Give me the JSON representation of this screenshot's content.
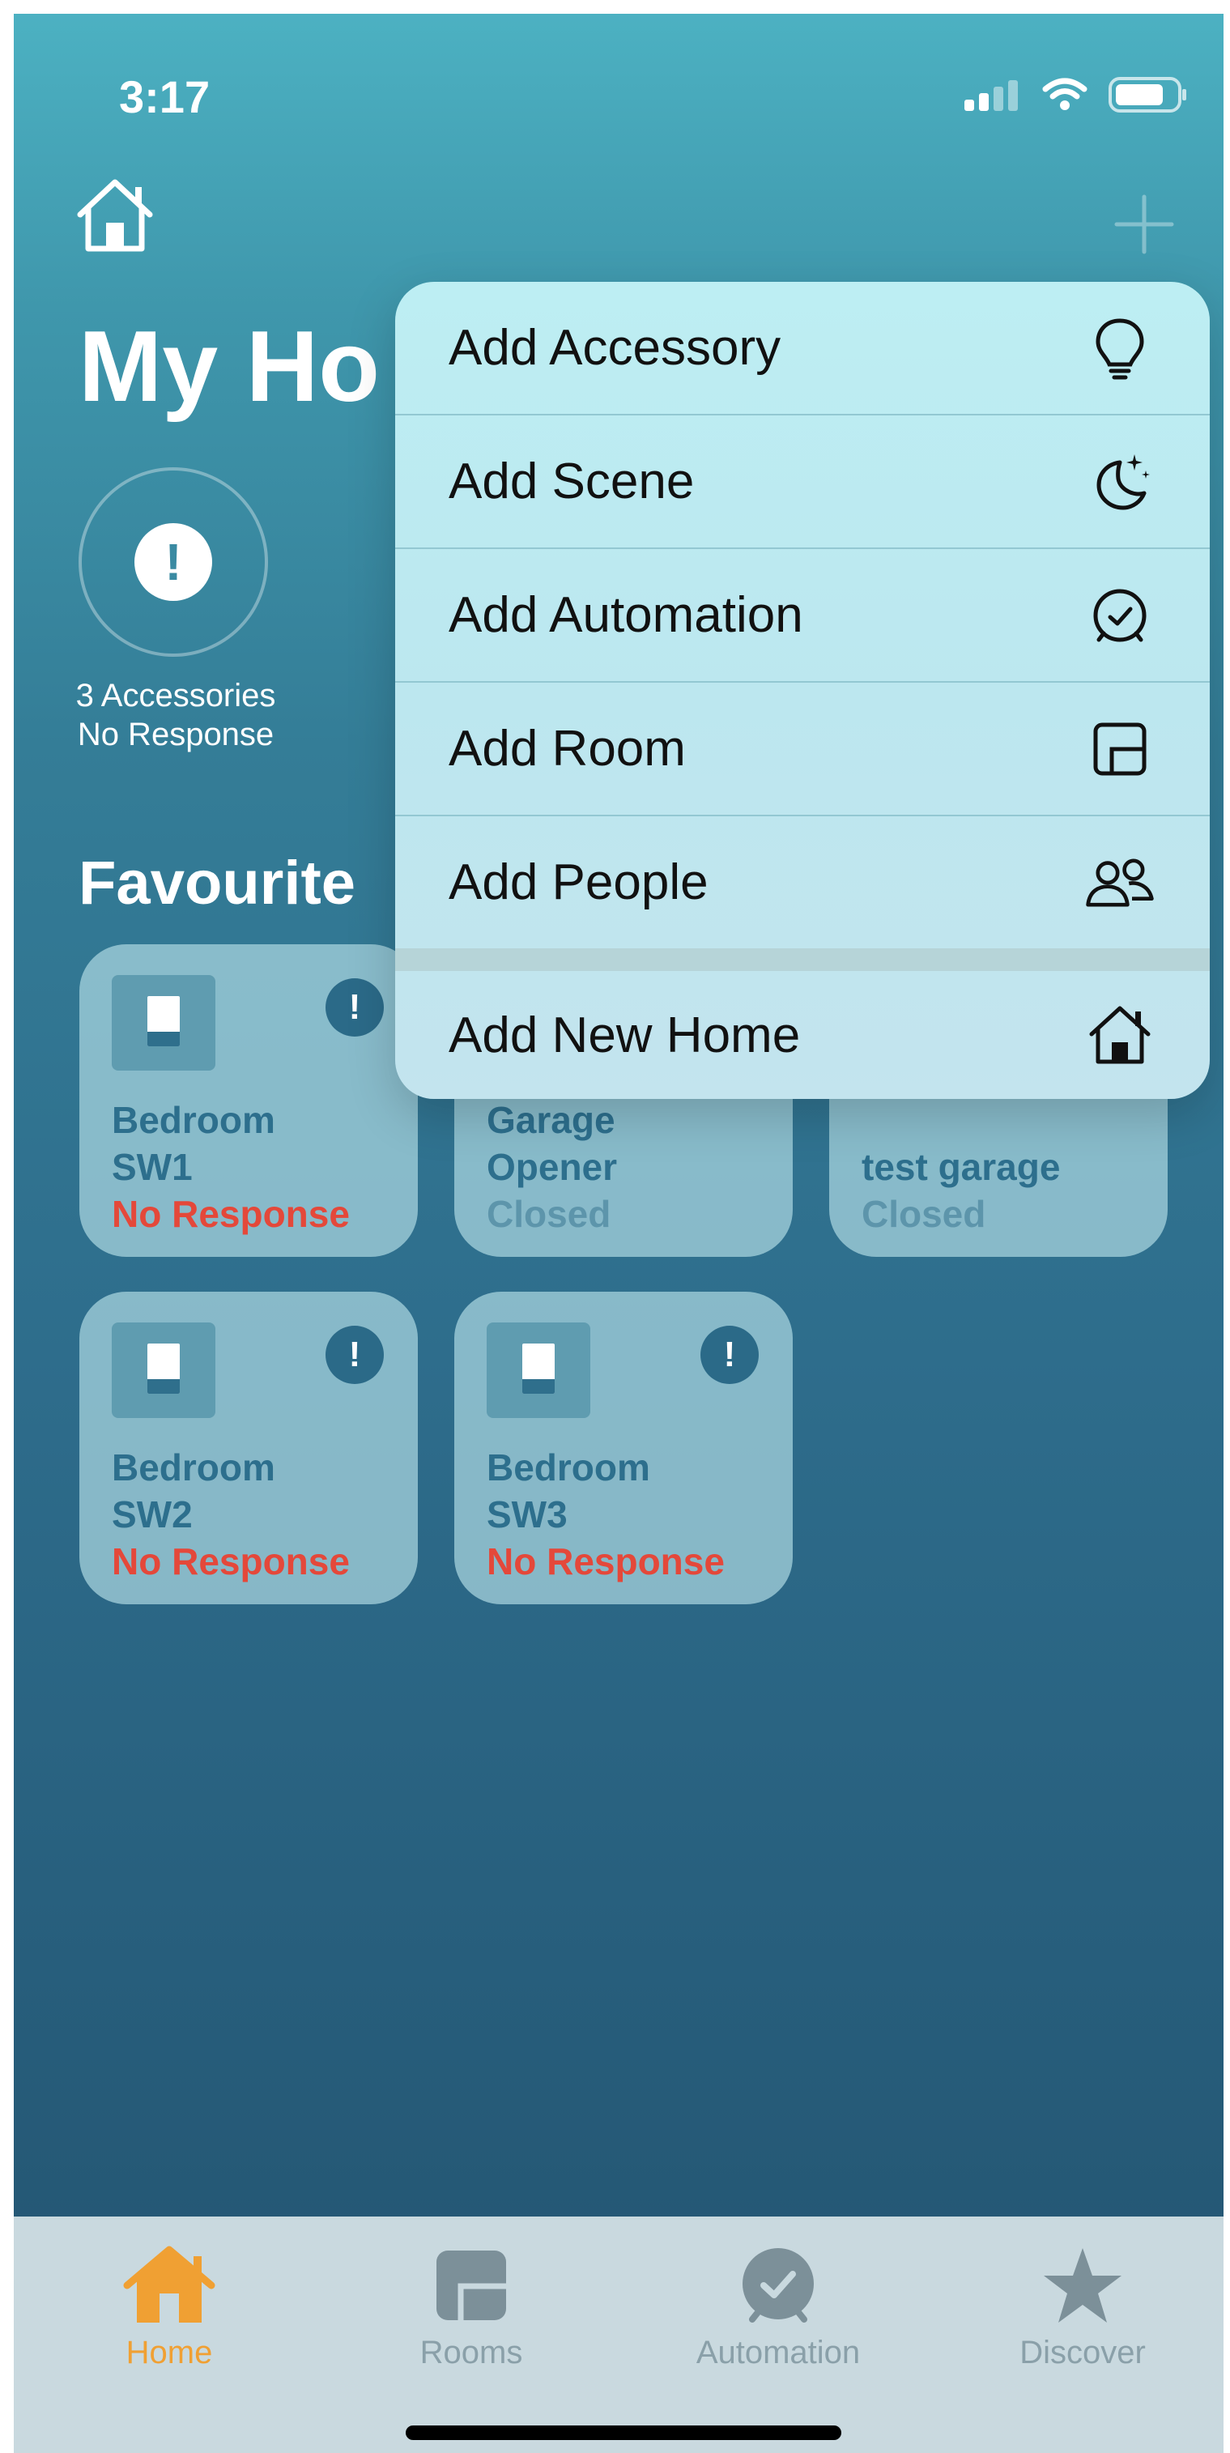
{
  "status_bar": {
    "time": "3:17"
  },
  "header": {
    "title": "My Ho"
  },
  "alert": {
    "symbol": "!",
    "line1": "3 Accessories",
    "line2": "No Response"
  },
  "section": {
    "title": "Favourite"
  },
  "tiles": [
    {
      "name_line1": "Bedroom",
      "name_line2": "SW1",
      "status": "No Response",
      "alert": "!"
    },
    {
      "name_line1": "Garage",
      "name_line2": "Opener",
      "status": "Closed"
    },
    {
      "name_line1": "",
      "name_line2": "test garage",
      "status": "Closed"
    },
    {
      "name_line1": "Bedroom",
      "name_line2": "SW2",
      "status": "No Response",
      "alert": "!"
    },
    {
      "name_line1": "Bedroom",
      "name_line2": "SW3",
      "status": "No Response",
      "alert": "!"
    }
  ],
  "menu": {
    "items": [
      {
        "label": "Add Accessory",
        "icon": "lightbulb-icon"
      },
      {
        "label": "Add Scene",
        "icon": "moon-stars-icon"
      },
      {
        "label": "Add Automation",
        "icon": "alarm-clock-icon"
      },
      {
        "label": "Add Room",
        "icon": "room-icon"
      },
      {
        "label": "Add People",
        "icon": "people-icon"
      },
      {
        "label": "Add New Home",
        "icon": "house-icon"
      }
    ]
  },
  "tabbar": {
    "tabs": [
      {
        "label": "Home",
        "icon": "house-icon",
        "active": true
      },
      {
        "label": "Rooms",
        "icon": "rooms-icon",
        "active": false
      },
      {
        "label": "Automation",
        "icon": "clock-check-icon",
        "active": false
      },
      {
        "label": "Discover",
        "icon": "star-icon",
        "active": false
      }
    ]
  },
  "colors": {
    "active_tab": "#f0a033",
    "no_response": "#e4483a",
    "menu_background": "#bde9f0"
  }
}
